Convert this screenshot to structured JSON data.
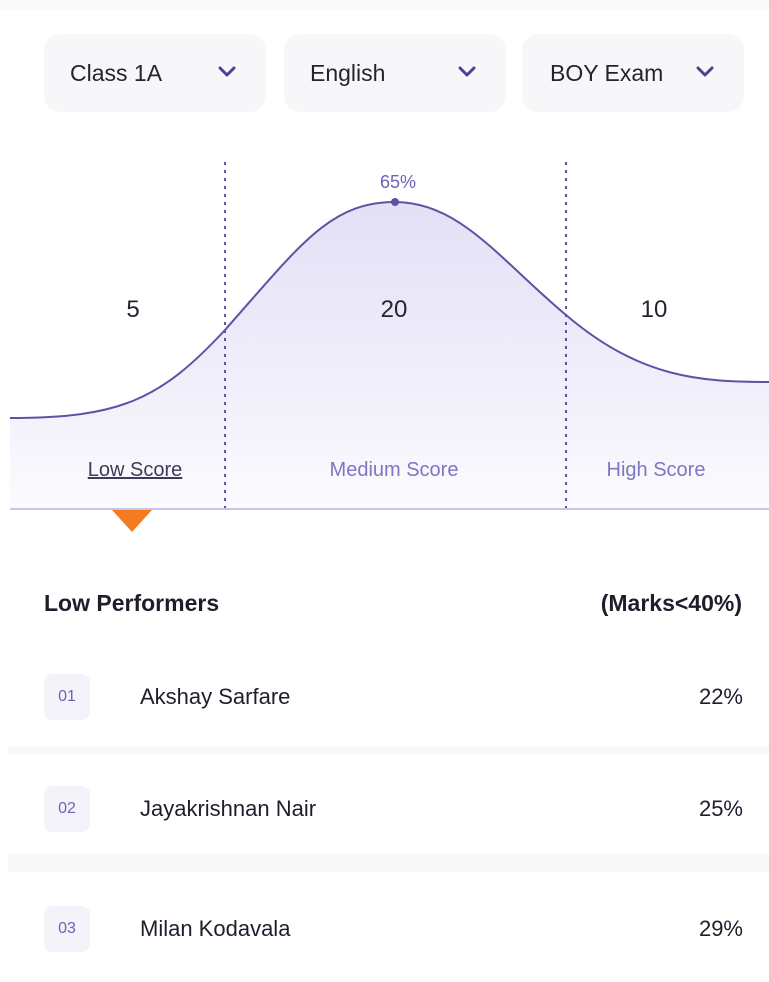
{
  "filters": {
    "class": "Class 1A",
    "subject": "English",
    "exam": "BOY Exam"
  },
  "chart_data": {
    "type": "area",
    "peak_label": "65%",
    "segments": [
      {
        "label": "Low Score",
        "count": "5",
        "selected": true
      },
      {
        "label": "Medium Score",
        "count": "20",
        "selected": false
      },
      {
        "label": "High Score",
        "count": "10",
        "selected": false
      }
    ]
  },
  "performers": {
    "title": "Low Performers",
    "note": "(Marks<40%)",
    "rows": [
      {
        "index": "01",
        "name": "Akshay Sarfare",
        "score": "22%"
      },
      {
        "index": "02",
        "name": "Jayakrishnan Nair",
        "score": "25%"
      },
      {
        "index": "03",
        "name": "Milan Kodavala",
        "score": "29%"
      }
    ]
  },
  "colors": {
    "accent": "#6b63b5",
    "curve": "#5b54a4",
    "marker": "#f47b20"
  }
}
